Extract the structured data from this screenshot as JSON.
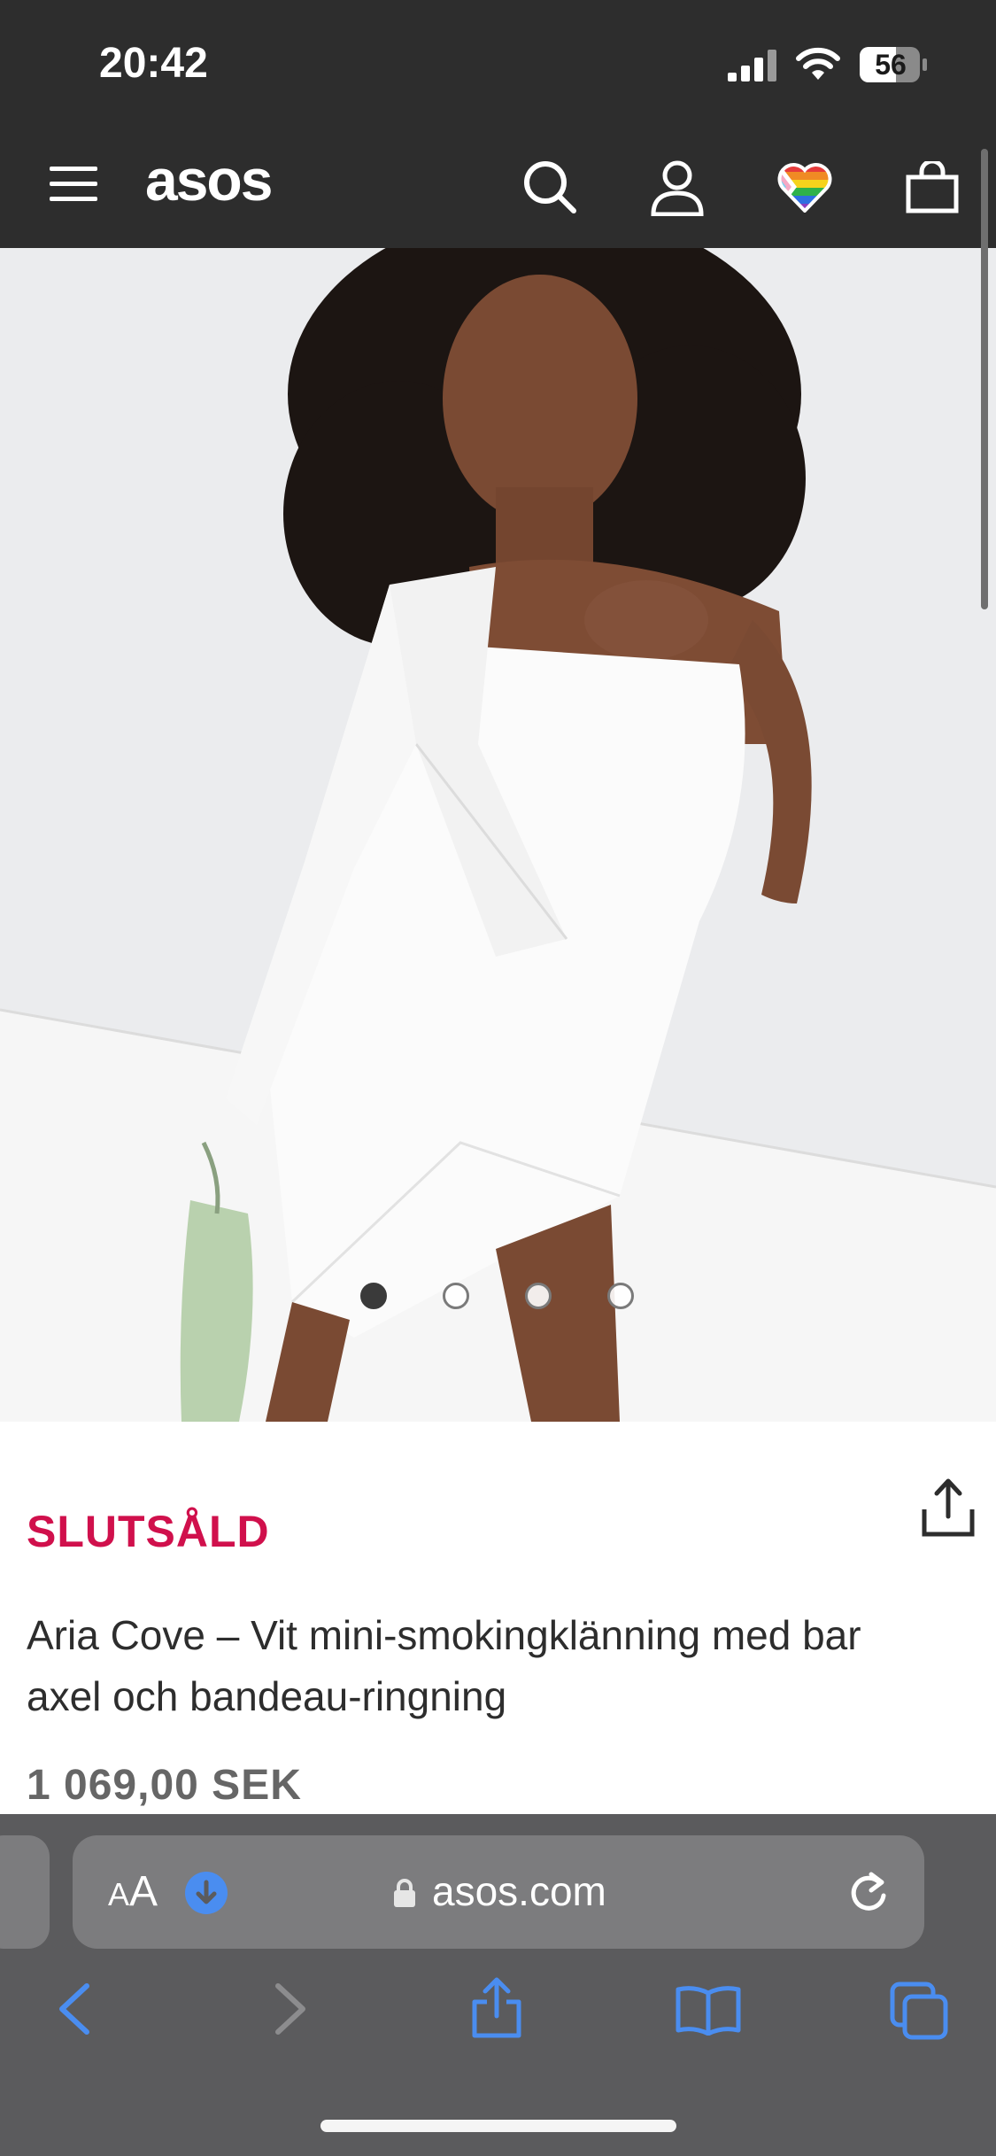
{
  "status_bar": {
    "time": "20:42",
    "battery": "56",
    "icons": [
      "signal-icon",
      "wifi-icon",
      "battery-icon"
    ]
  },
  "header": {
    "logo": "asos",
    "icons": [
      "menu-icon",
      "search-icon",
      "account-icon",
      "saved-items-heart-icon",
      "bag-icon"
    ]
  },
  "gallery": {
    "image_count": 4,
    "active_index": 0
  },
  "product": {
    "status": "SLUTSÅLD",
    "title": "Aria Cove – Vit mini-smokingklänning med bar axel och bandeau-ringning",
    "price": "1 069,00 SEK"
  },
  "browser": {
    "text_size_label_small": "A",
    "text_size_label_large": "A",
    "url": "asos.com",
    "toolbar_icons": [
      "back-icon",
      "forward-icon",
      "share-icon",
      "bookmarks-icon",
      "tabs-icon"
    ]
  },
  "colors": {
    "header_bg": "#2d2d2d",
    "sold_out": "#d0104c",
    "safari_bar": "#5b5b5d",
    "safari_accent": "#4a8df0"
  }
}
